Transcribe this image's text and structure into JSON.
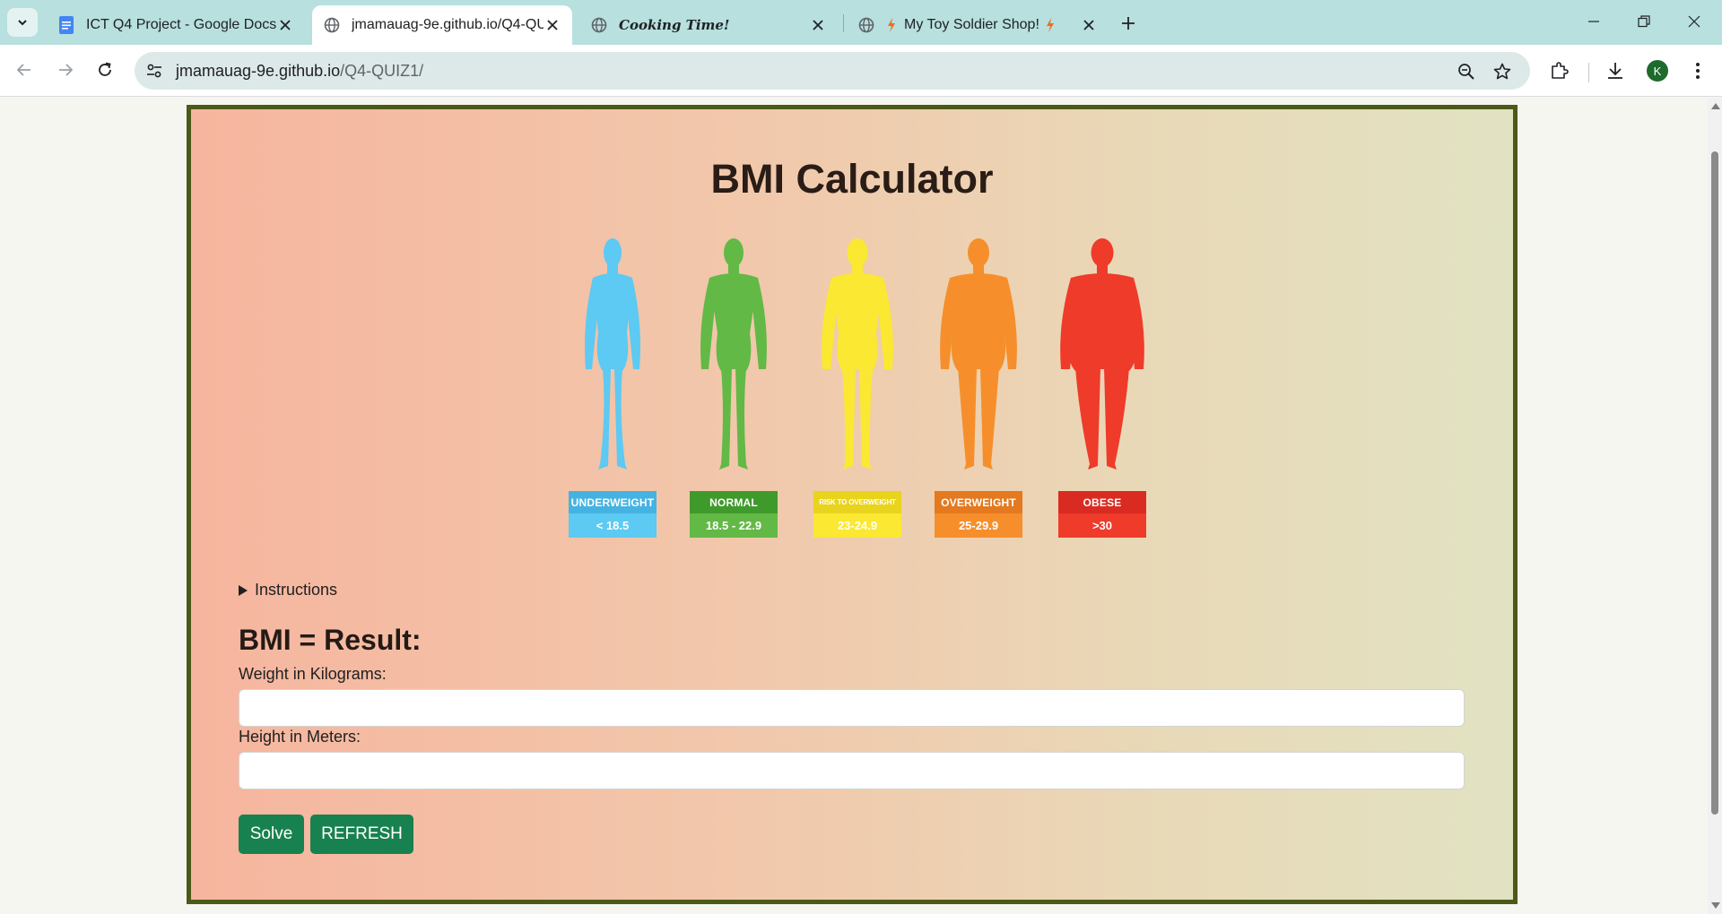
{
  "browser": {
    "tabs": [
      {
        "title": "ICT Q4 Project - Google Docs",
        "favicon": "google-docs-icon",
        "active": false
      },
      {
        "title": "jmamauag-9e.github.io/Q4-QUIZ1/",
        "favicon": "globe-icon",
        "active": true
      },
      {
        "title": "Cooking Time!",
        "favicon": "globe-icon",
        "active": false
      },
      {
        "title": "My Toy Soldier Shop!",
        "favicon": "globe-icon",
        "active": false
      }
    ],
    "url_host": "jmamauag-9e.github.io",
    "url_path": "/Q4-QUIZ1/",
    "profile_initial": "K"
  },
  "page": {
    "heading": "BMI Calculator",
    "categories": [
      {
        "label": "UNDERWEIGHT",
        "range": "< 18.5",
        "color": "#5ccaf2",
        "label_color": "#45b3e1",
        "build": "slim"
      },
      {
        "label": "NORMAL",
        "range": "18.5 - 22.9",
        "color": "#62b946",
        "label_color": "#3f9a2c",
        "build": "normal"
      },
      {
        "label": "RISK TO OVERWEIGHT",
        "range": "23-24.9",
        "color": "#fae832",
        "label_color": "#e9d41d",
        "build": "medium"
      },
      {
        "label": "OVERWEIGHT",
        "range": "25-29.9",
        "color": "#f68f2b",
        "label_color": "#e47920",
        "build": "heavy"
      },
      {
        "label": "OBESE",
        "range": ">30",
        "color": "#ef3b2a",
        "label_color": "#d92b22",
        "build": "obese"
      }
    ],
    "instructions_summary": "Instructions",
    "result_text": "BMI = Result:",
    "weight_label": "Weight in Kilograms:",
    "weight_value": "",
    "height_label": "Height in Meters:",
    "height_value": "",
    "solve_label": "Solve",
    "refresh_label": "REFRESH"
  }
}
